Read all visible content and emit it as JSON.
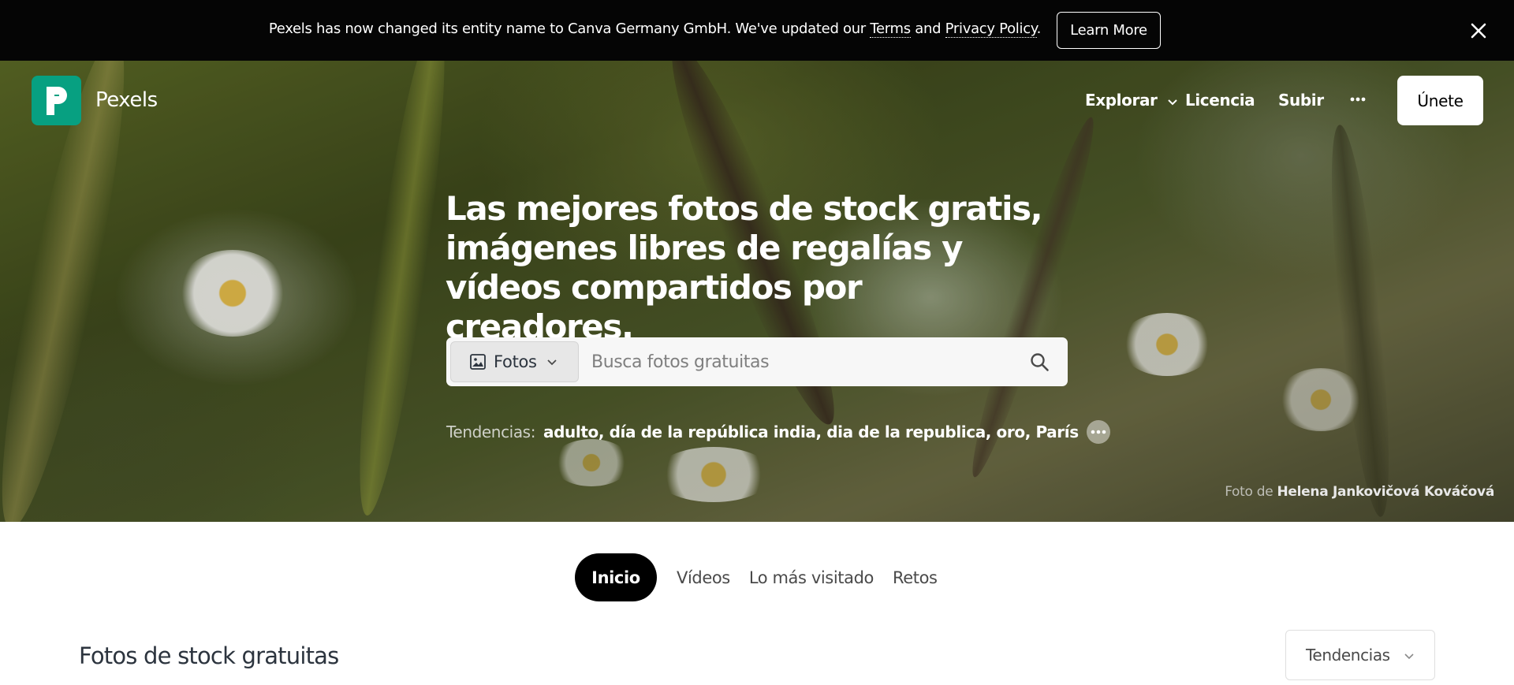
{
  "banner": {
    "text_before": "Pexels has now changed its entity name to Canva Germany GmbH. We've updated our ",
    "terms": "Terms",
    "and": " and ",
    "privacy": "Privacy Policy",
    "period": ".",
    "button": "Learn More"
  },
  "header": {
    "brand": "Pexels",
    "nav": {
      "explore": "Explorar",
      "license": "Licencia",
      "upload": "Subir"
    },
    "join": "Únete"
  },
  "hero": {
    "headline": "Las mejores fotos de stock gratis, imágenes libres de regalías y vídeos compartidos por creadores.",
    "search": {
      "type": "Fotos",
      "placeholder": "Busca fotos gratuitas"
    },
    "trends_label": "Tendencias:",
    "trends": "adulto, día de la república india, dia de la republica, oro, París",
    "credit_prefix": "Foto de ",
    "credit_author": "Helena Jankovičová Kováčová"
  },
  "tabs": [
    "Inicio",
    "Vídeos",
    "Lo más visitado",
    "Retos"
  ],
  "section": {
    "title": "Fotos de stock gratuitas",
    "sort": "Tendencias"
  },
  "colors": {
    "brand": "#07a081",
    "banner_bg": "#050505"
  }
}
